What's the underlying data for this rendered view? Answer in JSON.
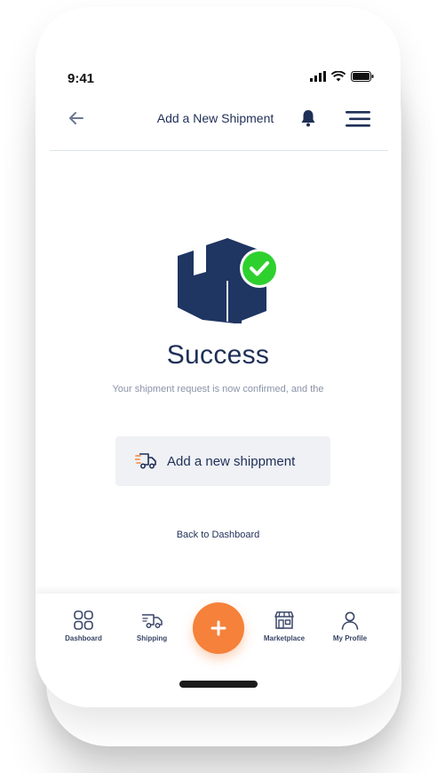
{
  "status_bar": {
    "time": "9:41"
  },
  "header": {
    "title": "Add a New Shipment"
  },
  "success": {
    "title": "Success",
    "message": "Your shipment request is now confirmed, and the"
  },
  "actions": {
    "add_shipment_label": "Add a new shippment",
    "back_to_dashboard_label": "Back to Dashboard"
  },
  "bottom_nav": {
    "items": [
      {
        "label": "Dashboard",
        "icon": "grid-icon"
      },
      {
        "label": "Shipping",
        "icon": "truck-icon"
      },
      {
        "label": "",
        "icon": "plus-icon"
      },
      {
        "label": "Marketplace",
        "icon": "store-icon"
      },
      {
        "label": "My Profile",
        "icon": "user-icon"
      }
    ]
  },
  "colors": {
    "primary_navy": "#1f3562",
    "accent_orange": "#f5813a",
    "success_green": "#2ed02e",
    "button_bg": "#eff1f5"
  }
}
